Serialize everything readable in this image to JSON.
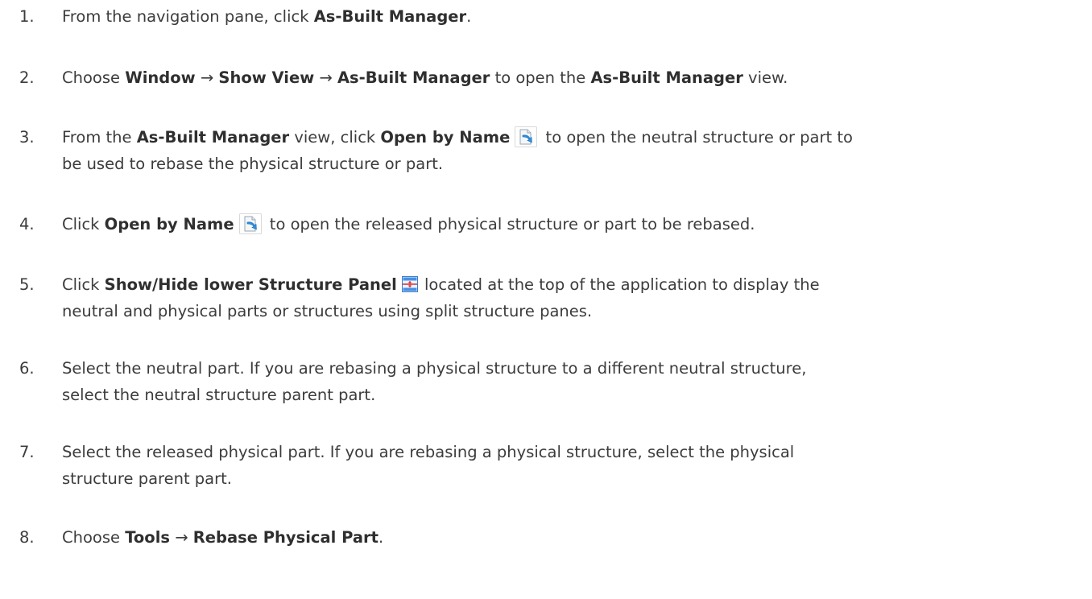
{
  "steps": [
    {
      "num": "1.",
      "t1": "From the navigation pane, click ",
      "b1": "As-Built Manager",
      "t2": "."
    },
    {
      "num": "2.",
      "t1": "Choose ",
      "b1": "Window",
      "a1": " → ",
      "b2": "Show View",
      "a2": " → ",
      "b3": "As-Built Manager",
      "t2": " to open the ",
      "b4": "As-Built Manager",
      "t3": " view."
    },
    {
      "num": "3.",
      "t1": "From the ",
      "b1": "As-Built Manager",
      "t2": " view, click ",
      "b2": "Open by Name",
      "icon": "open-by-name-icon",
      "t3": " to open the neutral structure or part to",
      "l2": "be used to rebase the physical structure or part."
    },
    {
      "num": "4.",
      "t1": "Click ",
      "b1": "Open by Name",
      "icon": "open-by-name-icon",
      "t2": " to open the released physical structure or part to be rebased."
    },
    {
      "num": "5.",
      "t1": "Click ",
      "b1": "Show/Hide lower Structure Panel",
      "icon": "split-panel-icon",
      "t2": " located at the top of the application to display the",
      "l2": "neutral and physical parts or structures using split structure panes."
    },
    {
      "num": "6.",
      "l1": "Select the neutral part. If you are rebasing a physical structure to a different neutral structure,",
      "l2": "select the neutral structure parent part."
    },
    {
      "num": "7.",
      "l1": "Select the released physical part. If you are rebasing a physical structure, select the physical",
      "l2": "structure parent part."
    },
    {
      "num": "8.",
      "t1": "Choose ",
      "b1": "Tools",
      "a1": " → ",
      "b2": "Rebase Physical Part",
      "t2": "."
    }
  ]
}
